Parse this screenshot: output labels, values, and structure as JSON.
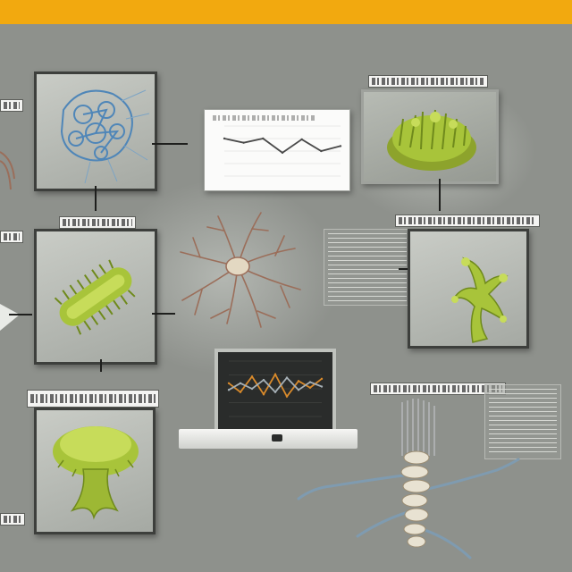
{
  "colors": {
    "background": "#8e918c",
    "top_bar": "#f2a90f",
    "specimen_green": "#a8c43a",
    "specimen_dark_green": "#6f8a1c",
    "network_blue": "#4f86b8",
    "neuron_brown": "#9b6e5a",
    "chart_orange": "#d98a2b",
    "frame_dark": "#3d3f3c"
  },
  "icons": {
    "protein_network": "network-diagram-icon",
    "moss_clump": "moss-specimen-icon",
    "algae_rod": "algae-rod-icon",
    "neuron": "neuron-cell-icon",
    "branching_moss": "branching-moss-icon",
    "mushroom_colony": "mushroom-colony-icon",
    "root_spine": "root-spine-icon",
    "line_chart": "line-chart-icon",
    "monitor_chart": "monitor-waveform-icon"
  },
  "chart_data": [
    {
      "type": "line",
      "x": [
        1,
        2,
        3,
        4,
        5,
        6,
        7
      ],
      "series": [
        {
          "values": [
            4.5,
            4.0,
            4.5,
            2.8,
            4.4,
            3.0,
            3.6
          ]
        }
      ],
      "ylim": [
        0,
        6
      ]
    },
    {
      "type": "line",
      "x": [
        1,
        2,
        3,
        4,
        5,
        6,
        7,
        8,
        9
      ],
      "series": [
        {
          "values": [
            3.0,
            2.2,
            3.6,
            2.0,
            3.8,
            1.8,
            3.2,
            2.6,
            3.4
          ]
        },
        {
          "values": [
            2.4,
            3.0,
            2.5,
            3.3,
            2.2,
            3.5,
            2.4,
            3.1,
            2.7
          ]
        }
      ],
      "ylim": [
        0,
        5
      ]
    }
  ]
}
